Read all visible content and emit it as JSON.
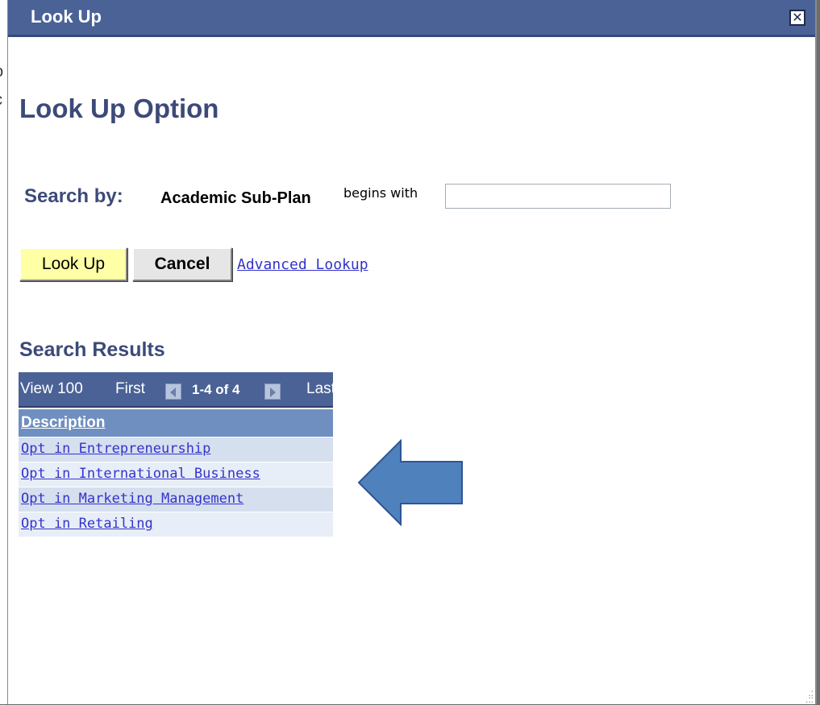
{
  "window": {
    "title": "Look Up",
    "close_icon": "close-box-icon",
    "accent_color": "#4a6296"
  },
  "page": {
    "title": "Look Up Option"
  },
  "search": {
    "label": "Search by:",
    "field": "Academic Sub-Plan",
    "operator": "begins with",
    "value": ""
  },
  "buttons": {
    "lookup": "Look Up",
    "cancel": "Cancel",
    "advanced": "Advanced Lookup"
  },
  "results": {
    "heading": "Search Results",
    "nav": {
      "view": "View 100",
      "first": "First",
      "range": "1-4 of 4",
      "last": "Last",
      "prev_icon": "previous-arrow-icon",
      "next_icon": "next-arrow-icon"
    },
    "column_header": "Description",
    "rows": [
      "Opt in Entrepreneurship",
      "Opt in International Business",
      "Opt in Marketing Management",
      "Opt in Retailing"
    ]
  },
  "annotation": {
    "arrow_icon": "left-pointing-arrow-icon",
    "color": "#4f81bd"
  }
}
